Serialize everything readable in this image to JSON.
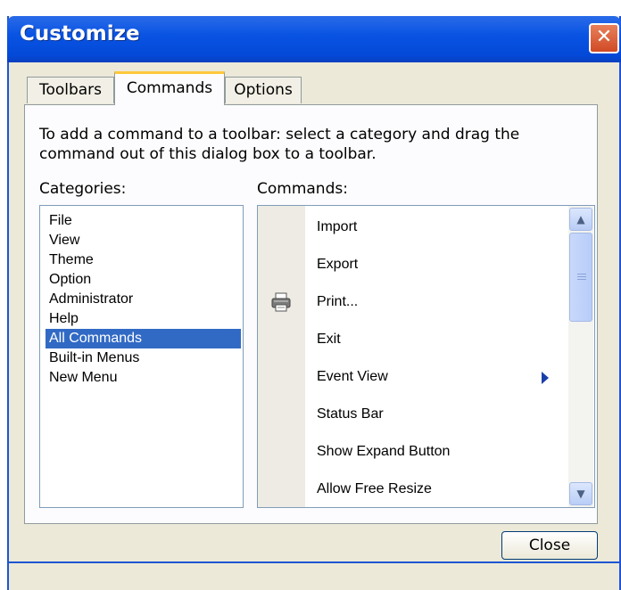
{
  "window": {
    "title": "Customize"
  },
  "tabs": [
    {
      "label": "Toolbars",
      "active": false
    },
    {
      "label": "Commands",
      "active": true
    },
    {
      "label": "Options",
      "active": false
    }
  ],
  "description": "To add a command to a toolbar: select a category and drag the command out of this dialog box to a toolbar.",
  "categories_label": "Categories:",
  "commands_label": "Commands:",
  "categories": [
    "File",
    "View",
    "Theme",
    "Option",
    "Administrator",
    "Help",
    "All Commands",
    "Built-in Menus",
    "New Menu"
  ],
  "selected_category": "All Commands",
  "commands": [
    {
      "label": "Import",
      "icon": ""
    },
    {
      "label": "Export",
      "icon": ""
    },
    {
      "label": "Print...",
      "icon": "printer-icon"
    },
    {
      "label": "Exit",
      "icon": ""
    },
    {
      "label": "Event View",
      "icon": "",
      "submenu": true
    },
    {
      "label": "Status Bar",
      "icon": ""
    },
    {
      "label": "Show Expand Button",
      "icon": ""
    },
    {
      "label": "Allow Free Resize",
      "icon": ""
    }
  ],
  "close_button": "Close",
  "colors": {
    "title_bar": "#0a54e3",
    "selection": "#316ac5",
    "tab_highlight": "#ffc83c",
    "close_x": "#d04a25"
  }
}
